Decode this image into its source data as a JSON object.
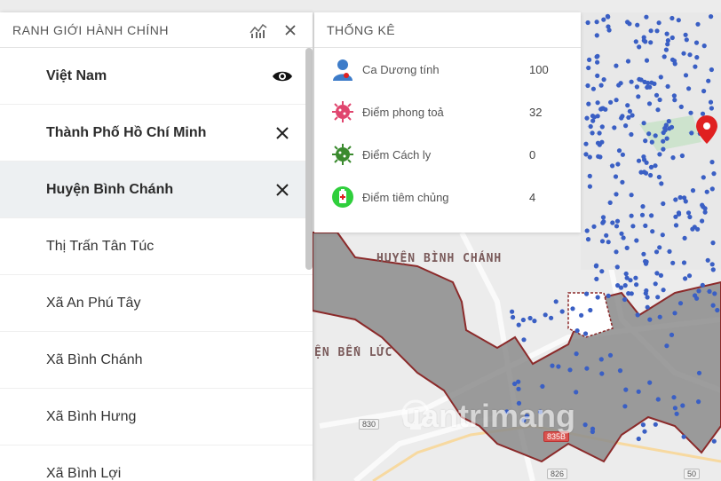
{
  "left_panel": {
    "title": "RANH GIỚI HÀNH CHÍNH",
    "chart_icon": "chart-icon",
    "close_icon": "close-icon",
    "items": [
      {
        "label": "Việt Nam",
        "action_icon": "eye-icon"
      },
      {
        "label": "Thành Phố Hồ Chí Minh",
        "action_icon": "close-icon"
      },
      {
        "label": "Huyện Bình Chánh",
        "action_icon": "close-icon"
      },
      {
        "label": "Thị Trấn Tân Túc"
      },
      {
        "label": "Xã An Phú Tây"
      },
      {
        "label": "Xã Bình Chánh"
      },
      {
        "label": "Xã Bình Hưng"
      },
      {
        "label": "Xã Bình Lợi"
      }
    ]
  },
  "stats_panel": {
    "title": "THỐNG KÊ",
    "rows": [
      {
        "label": "Ca Dương tính",
        "value": "100",
        "icon": "patient-icon",
        "color": "#3d7cc9"
      },
      {
        "label": "Điểm phong toả",
        "value": "32",
        "icon": "virus-icon",
        "color": "#e0456e"
      },
      {
        "label": "Điểm Cách ly",
        "value": "0",
        "icon": "virus-icon",
        "color": "#3a8a2e"
      },
      {
        "label": "Điểm tiêm chủng",
        "value": "4",
        "icon": "vaccine-icon",
        "color": "#2fcf3c"
      }
    ]
  },
  "map": {
    "district_label": "HUYỆN BÌNH CHÁNH",
    "ben_luc_label": "ỆN BẾN LỨC",
    "roads": [
      "830",
      "835B",
      "826",
      "50"
    ],
    "marker_color": "#3a5fc4",
    "pin_color": "#e02020",
    "watermark": "uantrimang"
  },
  "colors": {
    "accent": "#3a5fc4",
    "district_fill": "#8c8c8c",
    "district_border": "#8b2a2a"
  }
}
